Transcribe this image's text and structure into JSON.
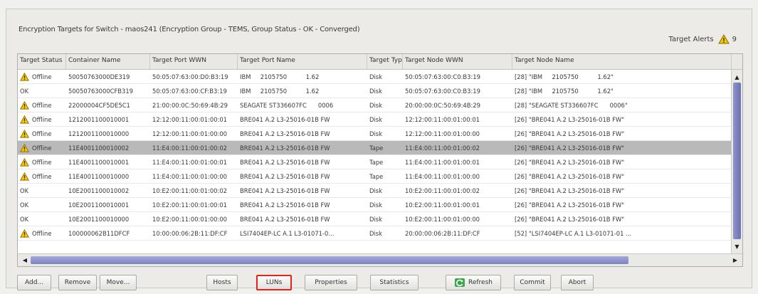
{
  "header": {
    "title": "Encryption Targets for Switch - maos241 (Encryption Group - TEMS, Group Status - OK - Converged)",
    "alerts_label": "Target Alerts",
    "alerts_count": "9"
  },
  "colors": {
    "selected_row": "#b9b9b9",
    "scroll_thumb": "#7d84c0",
    "highlight_border": "#e1251b",
    "warn_fill": "#f5c400"
  },
  "table": {
    "columns": [
      "Target Status",
      "Container Name",
      "Target Port WWN",
      "Target Port Name",
      "Target Type",
      "Target Node WWN",
      "Target Node Name"
    ],
    "rows": [
      {
        "status": "Offline",
        "warn": true,
        "container": "50050763000DE319",
        "wwn": "50:05:07:63:00:D0:B3:19",
        "pname": "IBM     2105750          1.62",
        "type": "Disk",
        "nwwn": "50:05:07:63:00:C0:B3:19",
        "nname": "[28] \"IBM     2105750          1.62\""
      },
      {
        "status": "OK",
        "warn": false,
        "container": "50050763000CFB319",
        "wwn": "50:05:07:63:00:CF:B3:19",
        "pname": "IBM     2105750          1.62",
        "type": "Disk",
        "nwwn": "50:05:07:63:00:C0:B3:19",
        "nname": "[28] \"IBM     2105750          1.62\""
      },
      {
        "status": "Offline",
        "warn": true,
        "container": "22000004CF5DE5C1",
        "wwn": "21:00:00:0C:50:69:4B:29",
        "pname": "SEAGATE ST336607FC      0006",
        "type": "Disk",
        "nwwn": "20:00:00:0C:50:69:4B:29",
        "nname": "[28] \"SEAGATE ST336607FC      0006\""
      },
      {
        "status": "Offline",
        "warn": true,
        "container": "1212001100010001",
        "wwn": "12:12:00:11:00:01:00:01",
        "pname": "BRE041 A.2 L3-25016-01B FW",
        "type": "Disk",
        "nwwn": "12:12:00:11:00:01:00:01",
        "nname": "[26] \"BRE041 A.2 L3-25016-01B FW\""
      },
      {
        "status": "Offline",
        "warn": true,
        "container": "1212001100010000",
        "wwn": "12:12:00:11:00:01:00:00",
        "pname": "BRE041 A.2 L3-25016-01B FW",
        "type": "Disk",
        "nwwn": "12:12:00:11:00:01:00:00",
        "nname": "[26] \"BRE041 A.2 L3-25016-01B FW\""
      },
      {
        "status": "Offline",
        "warn": true,
        "selected": true,
        "container": "11E4001100010002",
        "wwn": "11:E4:00:11:00:01:00:02",
        "pname": "BRE041 A.2 L3-25016-01B FW",
        "type": "Tape",
        "nwwn": "11:E4:00:11:00:01:00:02",
        "nname": "[26] \"BRE041 A.2 L3-25016-01B FW\""
      },
      {
        "status": "Offline",
        "warn": true,
        "container": "11E4001100010001",
        "wwn": "11:E4:00:11:00:01:00:01",
        "pname": "BRE041 A.2 L3-25016-01B FW",
        "type": "Tape",
        "nwwn": "11:E4:00:11:00:01:00:01",
        "nname": "[26] \"BRE041 A.2 L3-25016-01B FW\""
      },
      {
        "status": "Offline",
        "warn": true,
        "container": "11E4001100010000",
        "wwn": "11:E4:00:11:00:01:00:00",
        "pname": "BRE041 A.2 L3-25016-01B FW",
        "type": "Tape",
        "nwwn": "11:E4:00:11:00:01:00:00",
        "nname": "[26] \"BRE041 A.2 L3-25016-01B FW\""
      },
      {
        "status": "OK",
        "warn": false,
        "container": "10E2001100010002",
        "wwn": "10:E2:00:11:00:01:00:02",
        "pname": "BRE041 A.2 L3-25016-01B FW",
        "type": "Disk",
        "nwwn": "10:E2:00:11:00:01:00:02",
        "nname": "[26] \"BRE041 A.2 L3-25016-01B FW\""
      },
      {
        "status": "OK",
        "warn": false,
        "container": "10E2001100010001",
        "wwn": "10:E2:00:11:00:01:00:01",
        "pname": "BRE041 A.2 L3-25016-01B FW",
        "type": "Disk",
        "nwwn": "10:E2:00:11:00:01:00:01",
        "nname": "[26] \"BRE041 A.2 L3-25016-01B FW\""
      },
      {
        "status": "OK",
        "warn": false,
        "container": "10E2001100010000",
        "wwn": "10:E2:00:11:00:01:00:00",
        "pname": "BRE041 A.2 L3-25016-01B FW",
        "type": "Disk",
        "nwwn": "10:E2:00:11:00:01:00:00",
        "nname": "[26] \"BRE041 A.2 L3-25016-01B FW\""
      },
      {
        "status": "Offline",
        "warn": true,
        "container": "100000062B11DFCF",
        "wwn": "10:00:00:06:2B:11:DF:CF",
        "pname": "LSI7404EP-LC A.1 L3-01071-0...",
        "type": "Disk",
        "nwwn": "20:00:00:06:2B:11:DF:CF",
        "nname": "[52] \"LSI7404EP-LC A.1 L3-01071-01 ..."
      }
    ]
  },
  "buttons": {
    "add": "Add...",
    "remove": "Remove",
    "move": "Move...",
    "hosts": "Hosts",
    "luns": "LUNs",
    "properties": "Properties",
    "statistics": "Statistics",
    "refresh": "Refresh",
    "commit": "Commit",
    "abort": "Abort"
  }
}
